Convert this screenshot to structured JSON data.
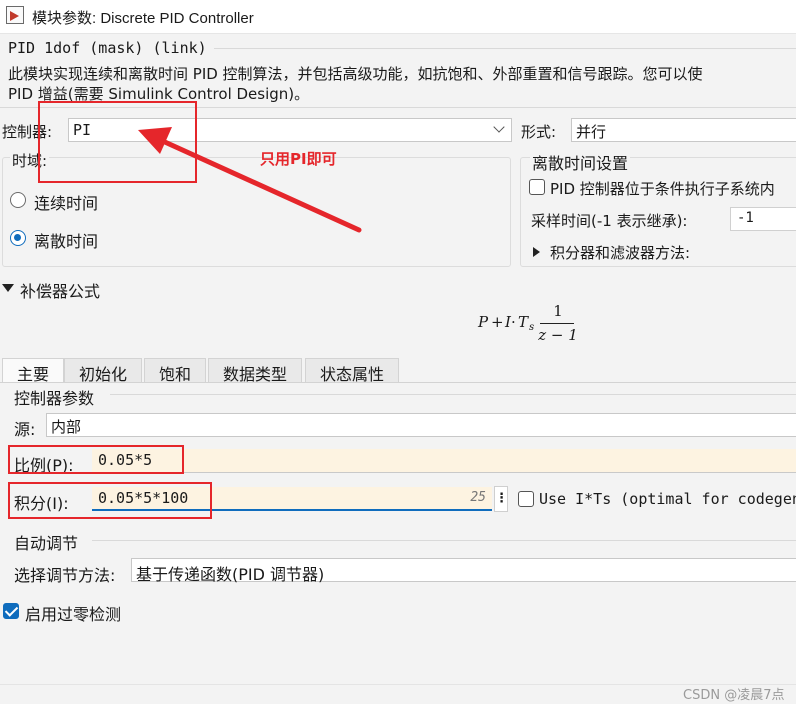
{
  "window": {
    "title": "模块参数: Discrete PID Controller"
  },
  "header": {
    "block_name": "PID 1dof (mask) (link)",
    "description_line1": "此模块实现连续和离散时间 PID 控制算法，并包括高级功能，如抗饱和、外部重置和信号跟踪。您可以使",
    "description_line2": "PID 增益(需要 Simulink Control Design)。"
  },
  "controller": {
    "label": "控制器:",
    "value": "PI"
  },
  "form": {
    "label": "形式:",
    "value": "并行"
  },
  "time_domain": {
    "label": "时域:",
    "options": [
      {
        "label": "连续时间",
        "selected": false
      },
      {
        "label": "离散时间",
        "selected": true
      }
    ]
  },
  "discrete_settings": {
    "title": "离散时间设置",
    "conditional_exec_label": "PID 控制器位于条件执行子系统内",
    "conditional_exec_checked": false,
    "sample_time_label": "采样时间(-1 表示继承):",
    "sample_time_value": "-1",
    "integrator_methods_label": "积分器和滤波器方法:"
  },
  "compensator": {
    "label": "补偿器公式",
    "formula": {
      "p": "P",
      "plus": "+",
      "i": "I",
      "dot": "·",
      "t": "T",
      "sub": "s",
      "num": "1",
      "den": "z − 1"
    }
  },
  "tabs": [
    "主要",
    "初始化",
    "饱和",
    "数据类型",
    "状态属性"
  ],
  "params": {
    "group_label": "控制器参数",
    "source_label": "源:",
    "source_value": "内部",
    "p_label": "比例(P):",
    "p_value": "0.05*5",
    "i_label": "积分(I):",
    "i_value": "0.05*5*100",
    "i_value_hint": "25",
    "use_its_label": "Use I*Ts (optimal for codegen)",
    "use_its_checked": false
  },
  "autotune": {
    "group_label": "自动调节",
    "method_label": "选择调节方法:",
    "method_value": "基于传递函数(PID 调节器)"
  },
  "zero_cross": {
    "label": "启用过零检测",
    "checked": true
  },
  "annotation": {
    "text": "只用PI即可"
  },
  "watermark": {
    "text": "CSDN @凌晨7点"
  },
  "colors": {
    "accent": "#0f6cbd",
    "annotation_red": "#e5262b",
    "field_cream": "#fdf3e1"
  }
}
